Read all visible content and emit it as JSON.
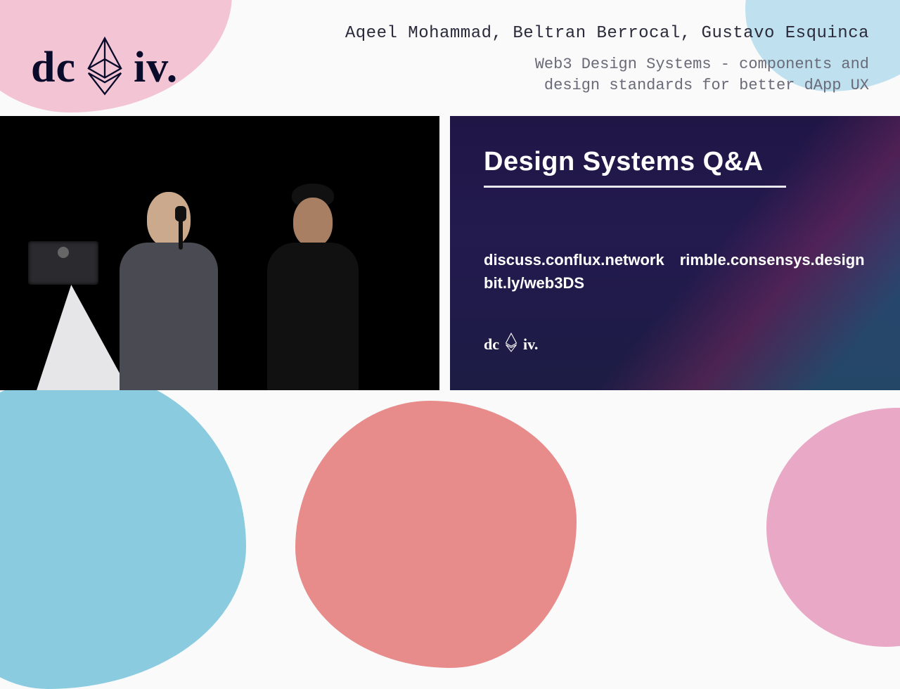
{
  "header": {
    "logo_left": "dc",
    "logo_right": "iv.",
    "speakers": "Aqeel Mohammad, Beltran Berrocal, Gustavo Esquinca",
    "talk_title_l1": "Web3 Design Systems - components and",
    "talk_title_l2": "design standards for better dApp UX"
  },
  "slide": {
    "title": "Design Systems Q&A",
    "link_col1_l1": "discuss.conflux.network",
    "link_col1_l2": "bit.ly/web3DS",
    "link_col2_l1": "rimble.consensys.design",
    "footer_logo_left": "dc",
    "footer_logo_right": "iv."
  }
}
